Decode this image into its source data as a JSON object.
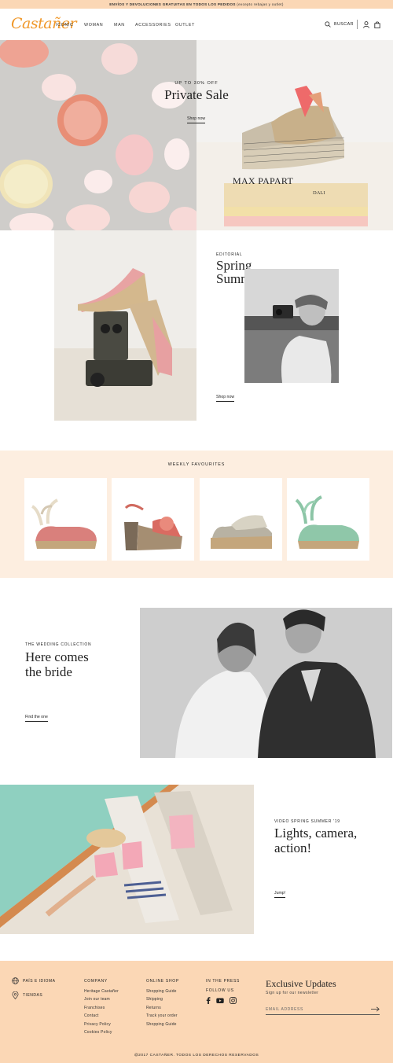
{
  "topbar": {
    "text": "ENVÍOS Y DEVOLUCIONES GRATUITAS EN TODOS LOS PEDIDOS",
    "note": "(excepto rebajas y outlet)"
  },
  "header": {
    "logo": "Castañer",
    "nav": [
      "ICONIC",
      "WOMAN",
      "MAN",
      "ACCESSORIES",
      "OUTLET"
    ],
    "search_label": "BUSCAR"
  },
  "hero": {
    "eyebrow": "UP TO 30% OFF",
    "title": "Private Sale",
    "link": "Shop now",
    "book_title": "MAX PAPART",
    "book_sub": "DALI"
  },
  "editorial": {
    "eyebrow": "EDITORIAL",
    "title_line1": "Spring",
    "title_line2": "Summer '19",
    "link": "Shop now"
  },
  "weekly": {
    "title": "WEEKLY FAVOURITES",
    "products": [
      {
        "name": "pink-wedge-espadrille"
      },
      {
        "name": "printed-platform-sandal"
      },
      {
        "name": "metallic-wedge-sandal"
      },
      {
        "name": "mint-wedge-espadrille"
      }
    ]
  },
  "wedding": {
    "eyebrow": "THE WEDDING COLLECTION",
    "title_line1": "Here comes",
    "title_line2": "the bride",
    "link": "Find the one"
  },
  "video": {
    "eyebrow": "VIDEO SPRING SUMMER '19",
    "title_line1": "Lights, camera,",
    "title_line2": "action!",
    "link": "Jump!"
  },
  "footer": {
    "country": "PAÍS E IDIOMA",
    "stores": "TIENDAS",
    "company": {
      "title": "COMPANY",
      "items": [
        "Heritage Castañer",
        "Join our team",
        "Franchises",
        "Contact",
        "Privacy Policy",
        "Cookies Policy"
      ]
    },
    "shop": {
      "title": "ONLINE SHOP",
      "items": [
        "Shopping Guide",
        "Shipping",
        "Returns",
        "Track your order",
        "Shopping Guide"
      ]
    },
    "press": "IN THE PRESS",
    "follow": "FOLLOW US",
    "newsletter_title": "Exclusive Updates",
    "newsletter_sub": "Sign up for our newsletter",
    "email_placeholder": "EMAIL ADDRESS",
    "copyright": "@2017 CASTAÑER. TODOS LOS DERECHOS RESERVADOS"
  },
  "colors": {
    "accent": "#f0982a",
    "peach": "#fbd7b5",
    "light_peach": "#fdeee0"
  }
}
